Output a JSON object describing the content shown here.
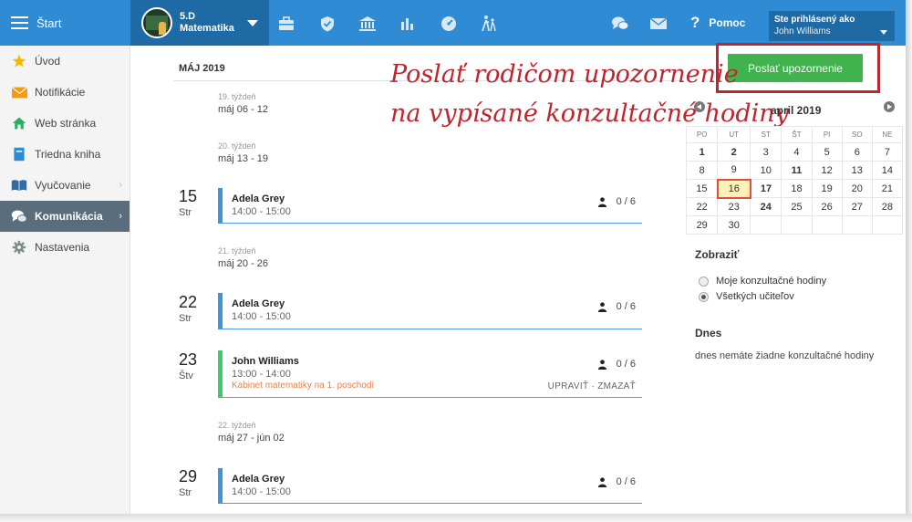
{
  "topbar": {
    "start_label": "Štart",
    "class_line1": "5.D",
    "class_line2": "Matematika",
    "icons": [
      "briefcase-icon",
      "shield-icon",
      "institution-icon",
      "bar-chart-icon",
      "gauge-icon",
      "walking-people-icon",
      "chat-icon",
      "mail-icon"
    ],
    "help_label": "Pomoc",
    "user_title": "Ste prihlásený ako",
    "user_name": "John Williams",
    "color": "#2e8bd4"
  },
  "sidebar": {
    "items": [
      {
        "label": "Úvod",
        "icon": "star-icon"
      },
      {
        "label": "Notifikácie",
        "icon": "envelope-icon"
      },
      {
        "label": "Web stránka",
        "icon": "home-icon"
      },
      {
        "label": "Triedna kniha",
        "icon": "book-icon"
      },
      {
        "label": "Vyučovanie",
        "icon": "open-book-icon"
      },
      {
        "label": "Komunikácia",
        "icon": "chat-icon",
        "active": true
      },
      {
        "label": "Nastavenia",
        "icon": "gear-icon"
      }
    ]
  },
  "schedule": {
    "month": "MÁJ 2019",
    "weeks": [
      {
        "label": "19. týždeň",
        "range": "máj 06 - 12"
      },
      {
        "label": "20. týždeň",
        "range": "máj 13 - 19"
      },
      {
        "label": "21. týždeň",
        "range": "máj 20 - 26"
      },
      {
        "label": "22. týždeň",
        "range": "máj 27 - jún 02"
      }
    ],
    "days": [
      {
        "num": "15",
        "name": "Str"
      },
      {
        "num": "22",
        "name": "Str"
      },
      {
        "num": "23",
        "name": "Štv"
      },
      {
        "num": "29",
        "name": "Str"
      }
    ],
    "slots": [
      {
        "name": "Adela Grey",
        "time": "14:00 - 15:00",
        "count": "0 / 6"
      },
      {
        "name": "Adela Grey",
        "time": "14:00 - 15:00",
        "count": "0 / 6"
      },
      {
        "name": "John Williams",
        "time": "13:00 - 14:00",
        "count": "0 / 6",
        "place": "Kabinet matematiky na 1. poschodí",
        "edit": "UPRAVIŤ",
        "sep": "·",
        "delete": "ZMAZAŤ"
      },
      {
        "name": "Adela Grey",
        "time": "14:00 - 15:00",
        "count": "0 / 6"
      }
    ]
  },
  "right": {
    "send_button": "Poslať upozornenie",
    "annotation_line1": "Poslať rodičom upozornenie",
    "annotation_line2": "na vypísané konzultačné hodiny",
    "calendar": {
      "title": "april 2019",
      "weekdays": [
        "PO",
        "UT",
        "ST",
        "ŠT",
        "PI",
        "SO",
        "NE"
      ],
      "weeks": [
        [
          "1",
          "2",
          "3",
          "4",
          "5",
          "6",
          "7"
        ],
        [
          "8",
          "9",
          "10",
          "11",
          "12",
          "13",
          "14"
        ],
        [
          "15",
          "16",
          "17",
          "18",
          "19",
          "20",
          "21"
        ],
        [
          "22",
          "23",
          "24",
          "25",
          "26",
          "27",
          "28"
        ],
        [
          "29",
          "30",
          "",
          "",
          "",
          "",
          ""
        ]
      ],
      "today": "16",
      "bold_days": [
        "1",
        "2",
        "11",
        "17",
        "24"
      ]
    },
    "show_title": "Zobraziť",
    "radio_options": [
      {
        "label": "Moje konzultačné hodiny",
        "checked": false
      },
      {
        "label": "Všetkých učiteľov",
        "checked": true
      }
    ],
    "today_title": "Dnes",
    "today_text": "dnes nemáte žiadne konzultačné hodiny",
    "accent_red": "#c0242c",
    "button_green": "#40b24e"
  }
}
